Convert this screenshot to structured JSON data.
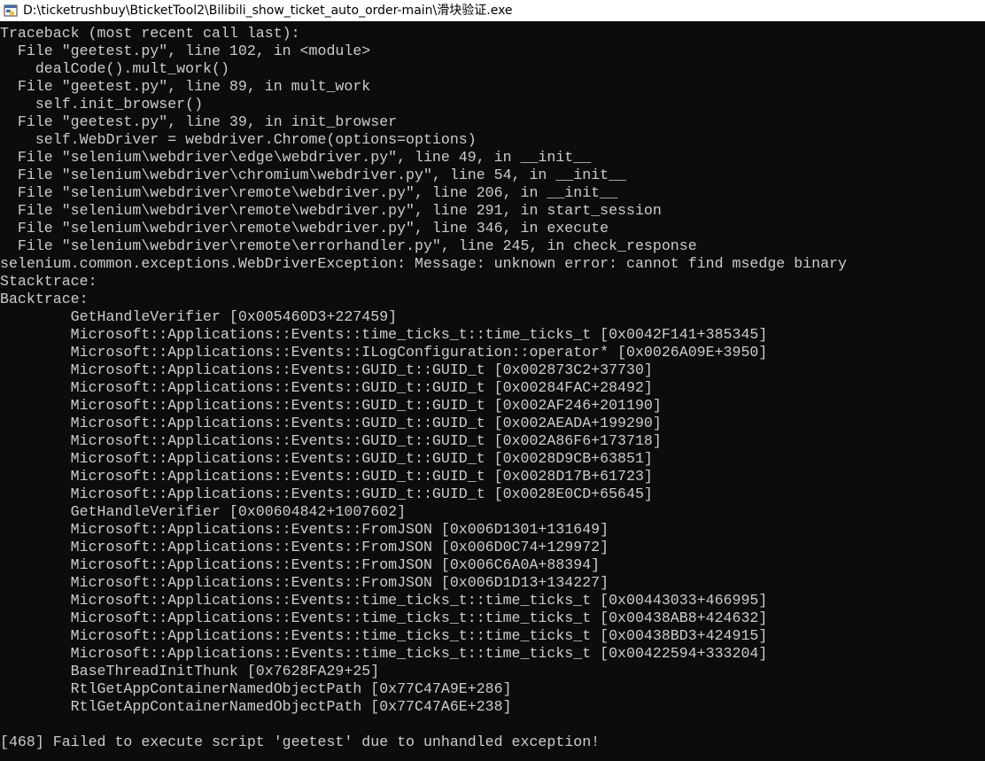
{
  "window": {
    "title": "D:\\ticketrushbuy\\BticketTool2\\Bilibili_show_ticket_auto_order-main\\滑块验证.exe",
    "icon": "python-executable-icon",
    "colors": {
      "background": "#0c0c0c",
      "text": "#cccccc",
      "titlebar": "#ffffff"
    }
  },
  "console": {
    "lines": [
      "Traceback (most recent call last):",
      "  File \"geetest.py\", line 102, in <module>",
      "    dealCode().mult_work()",
      "  File \"geetest.py\", line 89, in mult_work",
      "    self.init_browser()",
      "  File \"geetest.py\", line 39, in init_browser",
      "    self.WebDriver = webdriver.Chrome(options=options)",
      "  File \"selenium\\webdriver\\edge\\webdriver.py\", line 49, in __init__",
      "  File \"selenium\\webdriver\\chromium\\webdriver.py\", line 54, in __init__",
      "  File \"selenium\\webdriver\\remote\\webdriver.py\", line 206, in __init__",
      "  File \"selenium\\webdriver\\remote\\webdriver.py\", line 291, in start_session",
      "  File \"selenium\\webdriver\\remote\\webdriver.py\", line 346, in execute",
      "  File \"selenium\\webdriver\\remote\\errorhandler.py\", line 245, in check_response",
      "selenium.common.exceptions.WebDriverException: Message: unknown error: cannot find msedge binary",
      "Stacktrace:",
      "Backtrace:",
      "        GetHandleVerifier [0x005460D3+227459]",
      "        Microsoft::Applications::Events::time_ticks_t::time_ticks_t [0x0042F141+385345]",
      "        Microsoft::Applications::Events::ILogConfiguration::operator* [0x0026A09E+3950]",
      "        Microsoft::Applications::Events::GUID_t::GUID_t [0x002873C2+37730]",
      "        Microsoft::Applications::Events::GUID_t::GUID_t [0x00284FAC+28492]",
      "        Microsoft::Applications::Events::GUID_t::GUID_t [0x002AF246+201190]",
      "        Microsoft::Applications::Events::GUID_t::GUID_t [0x002AEADA+199290]",
      "        Microsoft::Applications::Events::GUID_t::GUID_t [0x002A86F6+173718]",
      "        Microsoft::Applications::Events::GUID_t::GUID_t [0x0028D9CB+63851]",
      "        Microsoft::Applications::Events::GUID_t::GUID_t [0x0028D17B+61723]",
      "        Microsoft::Applications::Events::GUID_t::GUID_t [0x0028E0CD+65645]",
      "        GetHandleVerifier [0x00604842+1007602]",
      "        Microsoft::Applications::Events::FromJSON [0x006D1301+131649]",
      "        Microsoft::Applications::Events::FromJSON [0x006D0C74+129972]",
      "        Microsoft::Applications::Events::FromJSON [0x006C6A0A+88394]",
      "        Microsoft::Applications::Events::FromJSON [0x006D1D13+134227]",
      "        Microsoft::Applications::Events::time_ticks_t::time_ticks_t [0x00443033+466995]",
      "        Microsoft::Applications::Events::time_ticks_t::time_ticks_t [0x00438AB8+424632]",
      "        Microsoft::Applications::Events::time_ticks_t::time_ticks_t [0x00438BD3+424915]",
      "        Microsoft::Applications::Events::time_ticks_t::time_ticks_t [0x00422594+333204]",
      "        BaseThreadInitThunk [0x7628FA29+25]",
      "        RtlGetAppContainerNamedObjectPath [0x77C47A9E+286]",
      "        RtlGetAppContainerNamedObjectPath [0x77C47A6E+238]",
      "",
      "[468] Failed to execute script 'geetest' due to unhandled exception!"
    ]
  }
}
